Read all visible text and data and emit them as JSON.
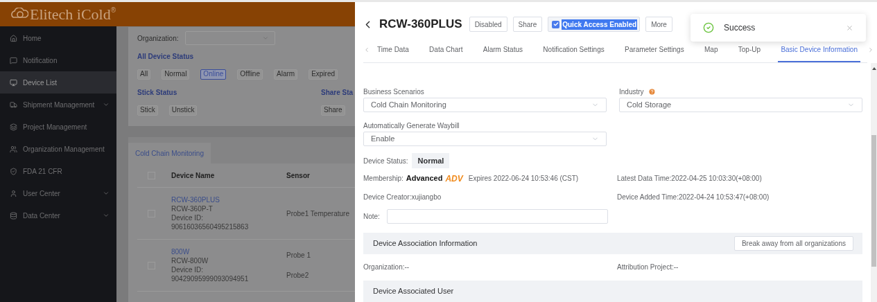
{
  "brand": {
    "name": "Elitech iCold",
    "mark": "®"
  },
  "sidebar": {
    "items": [
      {
        "label": "Home",
        "selected": false,
        "expandable": false
      },
      {
        "label": "Notification",
        "selected": false,
        "expandable": false
      },
      {
        "label": "Device List",
        "selected": true,
        "expandable": false
      },
      {
        "label": "Shipment Management",
        "selected": false,
        "expandable": true
      },
      {
        "label": "Project Management",
        "selected": false,
        "expandable": false
      },
      {
        "label": "Organization Management",
        "selected": false,
        "expandable": false
      },
      {
        "label": "FDA 21 CFR",
        "selected": false,
        "expandable": false
      },
      {
        "label": "User Center",
        "selected": false,
        "expandable": true
      },
      {
        "label": "Data Center",
        "selected": false,
        "expandable": true
      }
    ]
  },
  "filters": {
    "organization": {
      "label": "Organization:"
    },
    "groups": [
      {
        "title": "All Device Status",
        "options": [
          {
            "label": "All",
            "selected": false
          },
          {
            "label": "Normal",
            "selected": false
          },
          {
            "label": "Online",
            "selected": true
          },
          {
            "label": "Offline",
            "selected": false
          },
          {
            "label": "Alarm",
            "selected": false
          },
          {
            "label": "Expired",
            "selected": false
          }
        ]
      },
      {
        "title": "Stick Status",
        "options": [
          {
            "label": "Stick",
            "selected": false
          },
          {
            "label": "Unstick",
            "selected": false
          }
        ]
      },
      {
        "title": "Share Sta",
        "options": [
          {
            "label": "Share",
            "selected": false
          }
        ]
      }
    ]
  },
  "table": {
    "tab": "Cold Chain Monitoring",
    "select_all_checked": false,
    "columns": [
      "Device Name",
      "Sensor"
    ],
    "rows": [
      {
        "checked": false,
        "name": "RCW-360PLUS",
        "model": "RCW-360P-T",
        "id_label": "Device ID:",
        "id": "90616036560495215863",
        "sensors": [
          "Probe1 Temperature"
        ]
      },
      {
        "checked": false,
        "name": "800W",
        "model": "RCW-800W",
        "id_label": "Device ID:",
        "id": "90429095999093094951",
        "sensors": [
          "Probe 1",
          "Probe2"
        ]
      }
    ]
  },
  "drawer": {
    "title": "RCW-360PLUS",
    "actions": [
      {
        "kind": "button",
        "label": "Disabled"
      },
      {
        "kind": "button",
        "label": "Share"
      },
      {
        "kind": "checkbox",
        "label": "Quick Access Enabled",
        "checked": true
      },
      {
        "kind": "button",
        "label": "More"
      }
    ],
    "toast": {
      "message": "Success"
    },
    "tabs": [
      {
        "label": "Time Data",
        "selected": false
      },
      {
        "label": "Data Chart",
        "selected": false
      },
      {
        "label": "Alarm Status",
        "selected": false
      },
      {
        "label": "Notification Settings",
        "selected": false
      },
      {
        "label": "Parameter Settings",
        "selected": false
      },
      {
        "label": "Map",
        "selected": false
      },
      {
        "label": "Top-Up",
        "selected": false
      },
      {
        "label": "Basic Device Information",
        "selected": true
      }
    ],
    "fields": [
      {
        "label": "Business Scenarios",
        "value": "Cold Chain Monitoring",
        "help": false
      },
      {
        "label": "Industry",
        "value": "Cold Storage",
        "help": true
      },
      {
        "label": "Automatically Generate Waybill",
        "value": "Enable",
        "help": false
      }
    ],
    "status": {
      "label": "Device Status:",
      "value": "Normal"
    },
    "membership": {
      "label": "Membership:",
      "level": "Advanced",
      "badge": "ADV",
      "expires": "Expires 2022-06-24 10:53:46 (CST)"
    },
    "latest_data_time": "Latest Data Time:2022-04-25 10:03:30(+08:00)",
    "device_creator": "Device Creator:xujiangbo",
    "device_added_time": "Device Added Time:2022-04-24 10:53:47(+08:00)",
    "note": {
      "label": "Note:"
    },
    "association": {
      "title": "Device Association Information",
      "button": "Break away from all organizations",
      "organization": "Organization:--",
      "project": "Attribution Project:--"
    },
    "associated_user": {
      "title": "Device Associated User"
    }
  }
}
